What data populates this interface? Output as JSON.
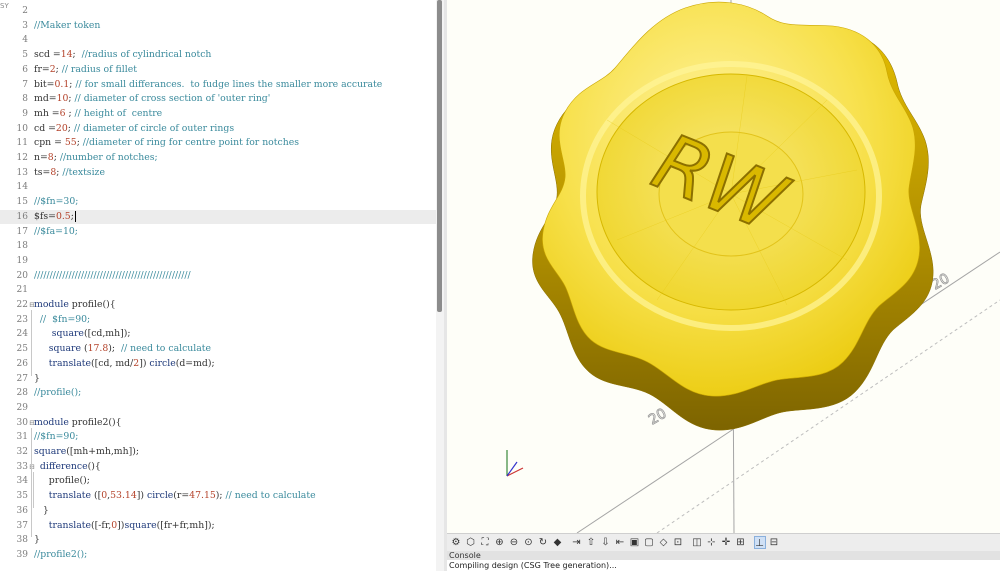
{
  "editor": {
    "top_label": "SY",
    "current_line": 16,
    "lines": [
      {
        "n": "2",
        "parts": []
      },
      {
        "n": "3",
        "parts": [
          {
            "c": "t-comment",
            "t": "//Maker token"
          }
        ]
      },
      {
        "n": "4",
        "parts": []
      },
      {
        "n": "5",
        "parts": [
          {
            "c": "t-var",
            "t": "scd "
          },
          {
            "c": "t-plain",
            "t": "="
          },
          {
            "c": "t-num",
            "t": "14"
          },
          {
            "c": "t-plain",
            "t": ";  "
          },
          {
            "c": "t-comment",
            "t": "//radius of cylindrical notch"
          }
        ]
      },
      {
        "n": "6",
        "parts": [
          {
            "c": "t-var",
            "t": "fr"
          },
          {
            "c": "t-plain",
            "t": "="
          },
          {
            "c": "t-num",
            "t": "2"
          },
          {
            "c": "t-plain",
            "t": "; "
          },
          {
            "c": "t-comment",
            "t": "// radius of fillet"
          }
        ]
      },
      {
        "n": "7",
        "parts": [
          {
            "c": "t-var",
            "t": "bit"
          },
          {
            "c": "t-plain",
            "t": "="
          },
          {
            "c": "t-num",
            "t": "0.1"
          },
          {
            "c": "t-plain",
            "t": "; "
          },
          {
            "c": "t-comment",
            "t": "// for small differances.  to fudge lines the smaller more accurate"
          }
        ]
      },
      {
        "n": "8",
        "parts": [
          {
            "c": "t-var",
            "t": "md"
          },
          {
            "c": "t-plain",
            "t": "="
          },
          {
            "c": "t-num",
            "t": "10"
          },
          {
            "c": "t-plain",
            "t": "; "
          },
          {
            "c": "t-comment",
            "t": "// diameter of cross section of 'outer ring'"
          }
        ]
      },
      {
        "n": "9",
        "parts": [
          {
            "c": "t-var",
            "t": "mh "
          },
          {
            "c": "t-plain",
            "t": "="
          },
          {
            "c": "t-num",
            "t": "6"
          },
          {
            "c": "t-plain",
            "t": " ; "
          },
          {
            "c": "t-comment",
            "t": "// height of  centre"
          }
        ]
      },
      {
        "n": "10",
        "parts": [
          {
            "c": "t-var",
            "t": "cd "
          },
          {
            "c": "t-plain",
            "t": "="
          },
          {
            "c": "t-num",
            "t": "20"
          },
          {
            "c": "t-plain",
            "t": "; "
          },
          {
            "c": "t-comment",
            "t": "// diameter of circle of outer rings"
          }
        ]
      },
      {
        "n": "11",
        "parts": [
          {
            "c": "t-var",
            "t": "cpn "
          },
          {
            "c": "t-plain",
            "t": "= "
          },
          {
            "c": "t-num",
            "t": "55"
          },
          {
            "c": "t-plain",
            "t": "; "
          },
          {
            "c": "t-comment",
            "t": "//diameter of ring for centre point for notches"
          }
        ]
      },
      {
        "n": "12",
        "parts": [
          {
            "c": "t-var",
            "t": "n"
          },
          {
            "c": "t-plain",
            "t": "="
          },
          {
            "c": "t-num",
            "t": "8"
          },
          {
            "c": "t-plain",
            "t": "; "
          },
          {
            "c": "t-comment",
            "t": "//number of notches;"
          }
        ]
      },
      {
        "n": "13",
        "parts": [
          {
            "c": "t-var",
            "t": "ts"
          },
          {
            "c": "t-plain",
            "t": "="
          },
          {
            "c": "t-num",
            "t": "8"
          },
          {
            "c": "t-plain",
            "t": "; "
          },
          {
            "c": "t-comment",
            "t": "//textsize"
          }
        ]
      },
      {
        "n": "14",
        "parts": []
      },
      {
        "n": "15",
        "parts": [
          {
            "c": "t-comment",
            "t": "//$fn=30;"
          }
        ]
      },
      {
        "n": "16",
        "parts": [
          {
            "c": "t-var",
            "t": "$fs"
          },
          {
            "c": "t-plain",
            "t": "="
          },
          {
            "c": "t-num",
            "t": "0.5"
          },
          {
            "c": "t-plain",
            "t": ";"
          }
        ],
        "caret": true
      },
      {
        "n": "17",
        "parts": [
          {
            "c": "t-comment",
            "t": "//$fa=10;"
          }
        ]
      },
      {
        "n": "18",
        "parts": []
      },
      {
        "n": "19",
        "parts": []
      },
      {
        "n": "20",
        "parts": [
          {
            "c": "t-comment",
            "t": "//////////////////////////////////////////////////"
          }
        ]
      },
      {
        "n": "21",
        "parts": []
      },
      {
        "n": "22",
        "fold": true,
        "parts": [
          {
            "c": "t-kw",
            "t": "module "
          },
          {
            "c": "t-plain",
            "t": "profile(){"
          }
        ]
      },
      {
        "n": "23",
        "parts": [
          {
            "c": "t-plain",
            "t": "  "
          },
          {
            "c": "t-comment",
            "t": "//  $fn=90;"
          }
        ]
      },
      {
        "n": "24",
        "parts": [
          {
            "c": "t-plain",
            "t": "      "
          },
          {
            "c": "t-kw",
            "t": "square"
          },
          {
            "c": "t-plain",
            "t": "([cd,mh]);"
          }
        ]
      },
      {
        "n": "25",
        "parts": [
          {
            "c": "t-plain",
            "t": "     "
          },
          {
            "c": "t-kw",
            "t": "square "
          },
          {
            "c": "t-plain",
            "t": "("
          },
          {
            "c": "t-num",
            "t": "17.8"
          },
          {
            "c": "t-plain",
            "t": ");  "
          },
          {
            "c": "t-comment",
            "t": "// need to calculate"
          }
        ]
      },
      {
        "n": "26",
        "parts": [
          {
            "c": "t-plain",
            "t": "     "
          },
          {
            "c": "t-kw",
            "t": "translate"
          },
          {
            "c": "t-plain",
            "t": "([cd, md/"
          },
          {
            "c": "t-num",
            "t": "2"
          },
          {
            "c": "t-plain",
            "t": "]) "
          },
          {
            "c": "t-kw",
            "t": "circle"
          },
          {
            "c": "t-plain",
            "t": "(d=md);"
          }
        ]
      },
      {
        "n": "27",
        "parts": [
          {
            "c": "t-plain",
            "t": "}"
          }
        ]
      },
      {
        "n": "28",
        "parts": [
          {
            "c": "t-comment",
            "t": "//profile();"
          }
        ]
      },
      {
        "n": "29",
        "parts": []
      },
      {
        "n": "30",
        "fold": true,
        "parts": [
          {
            "c": "t-kw",
            "t": "module "
          },
          {
            "c": "t-plain",
            "t": "profile2(){"
          }
        ]
      },
      {
        "n": "31",
        "parts": [
          {
            "c": "t-comment",
            "t": "//$fn=90;"
          }
        ]
      },
      {
        "n": "32",
        "parts": [
          {
            "c": "t-kw",
            "t": "square"
          },
          {
            "c": "t-plain",
            "t": "([mh+mh,mh]);"
          }
        ]
      },
      {
        "n": "33",
        "fold": true,
        "parts": [
          {
            "c": "t-plain",
            "t": "  "
          },
          {
            "c": "t-kw",
            "t": "difference"
          },
          {
            "c": "t-plain",
            "t": "(){"
          }
        ]
      },
      {
        "n": "34",
        "parts": [
          {
            "c": "t-plain",
            "t": "     profile();"
          }
        ]
      },
      {
        "n": "35",
        "parts": [
          {
            "c": "t-plain",
            "t": "     "
          },
          {
            "c": "t-kw",
            "t": "translate "
          },
          {
            "c": "t-plain",
            "t": "(["
          },
          {
            "c": "t-num",
            "t": "0"
          },
          {
            "c": "t-plain",
            "t": ","
          },
          {
            "c": "t-num",
            "t": "53.14"
          },
          {
            "c": "t-plain",
            "t": "]) "
          },
          {
            "c": "t-kw",
            "t": "circle"
          },
          {
            "c": "t-plain",
            "t": "(r="
          },
          {
            "c": "t-num",
            "t": "47.15"
          },
          {
            "c": "t-plain",
            "t": "); "
          },
          {
            "c": "t-comment",
            "t": "// need to calculate"
          }
        ]
      },
      {
        "n": "36",
        "parts": [
          {
            "c": "t-plain",
            "t": "   }"
          }
        ]
      },
      {
        "n": "37",
        "parts": [
          {
            "c": "t-plain",
            "t": "     "
          },
          {
            "c": "t-kw",
            "t": "translate"
          },
          {
            "c": "t-plain",
            "t": "([-fr,"
          },
          {
            "c": "t-num",
            "t": "0"
          },
          {
            "c": "t-plain",
            "t": "])"
          },
          {
            "c": "t-kw",
            "t": "square"
          },
          {
            "c": "t-plain",
            "t": "([fr+fr,mh]);"
          }
        ]
      },
      {
        "n": "38",
        "parts": [
          {
            "c": "t-plain",
            "t": "}"
          }
        ]
      },
      {
        "n": "39",
        "parts": [
          {
            "c": "t-comment",
            "t": "//profile2();"
          }
        ]
      }
    ]
  },
  "viewport": {
    "model_text": "RW",
    "axis_labels": [
      "20",
      "20",
      "20"
    ],
    "colors": {
      "model": "#f2d80a",
      "model_dark": "#c9a500",
      "model_light": "#fff07a",
      "axes": "#9a9a9a"
    }
  },
  "toolbar": {
    "buttons": [
      {
        "name": "preview-button-icon",
        "glyph": "⚙"
      },
      {
        "name": "render-button-icon",
        "glyph": "⬡"
      },
      {
        "name": "view-all-icon",
        "glyph": "⛶"
      },
      {
        "name": "zoom-in-icon",
        "glyph": "⊕"
      },
      {
        "name": "zoom-out-icon",
        "glyph": "⊖"
      },
      {
        "name": "zoom-fit-icon",
        "glyph": "⊙"
      },
      {
        "name": "reset-view-icon",
        "glyph": "↻"
      },
      {
        "name": "perspective-icon",
        "glyph": "◆"
      },
      {
        "name": "view-right-icon",
        "glyph": "⇥"
      },
      {
        "name": "view-top-icon",
        "glyph": "⇧"
      },
      {
        "name": "view-bottom-icon",
        "glyph": "⇩"
      },
      {
        "name": "view-left-icon",
        "glyph": "⇤"
      },
      {
        "name": "view-front-icon",
        "glyph": "▣"
      },
      {
        "name": "view-back-icon",
        "glyph": "▢"
      },
      {
        "name": "view-diagonal-icon",
        "glyph": "◇"
      },
      {
        "name": "view-center-icon",
        "glyph": "⊡"
      },
      {
        "name": "ortho-icon",
        "glyph": "◫"
      },
      {
        "name": "axes-icon",
        "glyph": "⊹"
      },
      {
        "name": "crosshairs-icon",
        "glyph": "✛"
      },
      {
        "name": "edges-icon",
        "glyph": "⊞"
      },
      {
        "name": "show-axes-toggle-icon",
        "glyph": "⊥"
      },
      {
        "name": "scale-markers-icon",
        "glyph": "⊟"
      }
    ],
    "active_index": 20
  },
  "console": {
    "title": "Console",
    "message": "Compiling design (CSG Tree generation)..."
  }
}
